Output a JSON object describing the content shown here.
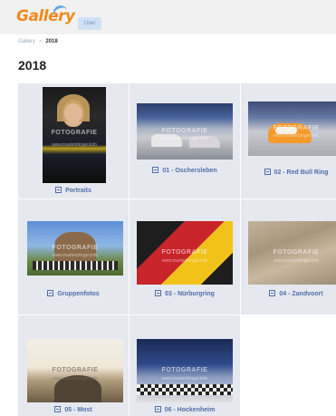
{
  "header": {
    "logo_text": "Gallery",
    "user_button": "User"
  },
  "breadcrumb": {
    "root": "Gallery",
    "separator": "»",
    "current": "2018"
  },
  "page": {
    "title": "2018"
  },
  "watermark": {
    "text": "FOTOGRAFIE",
    "url": "www.marlenbingel.info"
  },
  "albums": [
    {
      "label": "Portraits",
      "icon": "album-icon"
    },
    {
      "label": "01 - Oschersleben",
      "icon": "album-icon"
    },
    {
      "label": "02 - Red Bull Ring",
      "icon": "album-icon"
    },
    {
      "label": "Gruppenfotos",
      "icon": "album-icon"
    },
    {
      "label": "03 - Nürburgring",
      "icon": "album-icon"
    },
    {
      "label": "04 - Zandvoort",
      "icon": "album-icon"
    },
    {
      "label": "05 - Most",
      "icon": "album-icon"
    },
    {
      "label": "06 - Hockenheim",
      "icon": "album-icon"
    }
  ],
  "colors": {
    "brand_orange": "#f08a1c",
    "link_blue": "#4f6fa8",
    "tile_bg": "#e5e8ef"
  }
}
